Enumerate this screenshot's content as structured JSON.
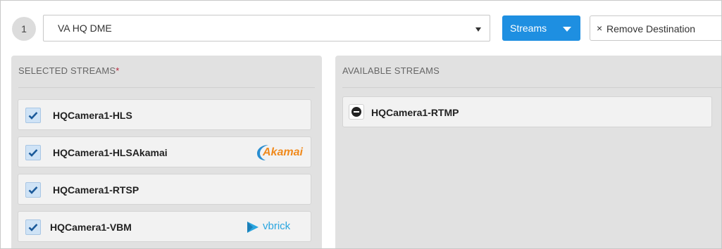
{
  "destination": {
    "step_number": "1",
    "selected_value": "VA HQ DME",
    "streams_button_label": "Streams",
    "remove_label": "Remove Destination",
    "remove_icon": "×"
  },
  "selected_streams": {
    "heading": "SELECTED STREAMS",
    "required_marker": "*",
    "items": [
      {
        "name": "HQCamera1-HLS",
        "checked": true,
        "logo": ""
      },
      {
        "name": "HQCamera1-HLSAkamai",
        "checked": true,
        "logo": "Akamai"
      },
      {
        "name": "HQCamera1-RTSP",
        "checked": true,
        "logo": ""
      },
      {
        "name": "HQCamera1-VBM",
        "checked": true,
        "logo": "vbrick"
      }
    ]
  },
  "available_streams": {
    "heading": "AVAILABLE STREAMS",
    "items": [
      {
        "name": "HQCamera1-RTMP"
      }
    ]
  },
  "colors": {
    "accent": "#1e8fe1",
    "panel_bg": "#e1e1e1",
    "akamai": "#f08a1d",
    "vbrick": "#2aa6e0",
    "required": "#b9243a"
  }
}
